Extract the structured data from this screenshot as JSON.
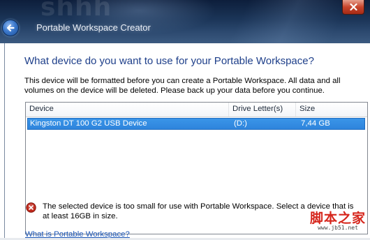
{
  "window": {
    "title": "Portable Workspace Creator",
    "watermark": "shhh",
    "back_icon": "back-arrow-icon",
    "close_icon": "close-icon"
  },
  "page": {
    "heading": "What device do you want to use for your Portable Workspace?",
    "description": "This device will be formatted before you can create a Portable Workspace. All data and all volumes on the device will be deleted. Please back up your data before you continue."
  },
  "device_table": {
    "columns": [
      "Device",
      "Drive Letter(s)",
      "Size"
    ],
    "rows": [
      {
        "device": "Kingston DT 100 G2 USB Device",
        "drive_letters": "(D:)",
        "size": "7,44 GB",
        "selected": true
      }
    ]
  },
  "error": {
    "icon": "error-icon",
    "message": "The selected device is too small for use with Portable Workspace. Select a device that is at least 16GB in size."
  },
  "help_link": "What is Portable Workspace?",
  "site_logo": {
    "text": "脚本之家",
    "url": "www.jb51.net"
  },
  "colors": {
    "heading": "#1e3f8a",
    "selection": "#3a95e8",
    "link": "#1a55b6",
    "error": "#c0281b"
  }
}
